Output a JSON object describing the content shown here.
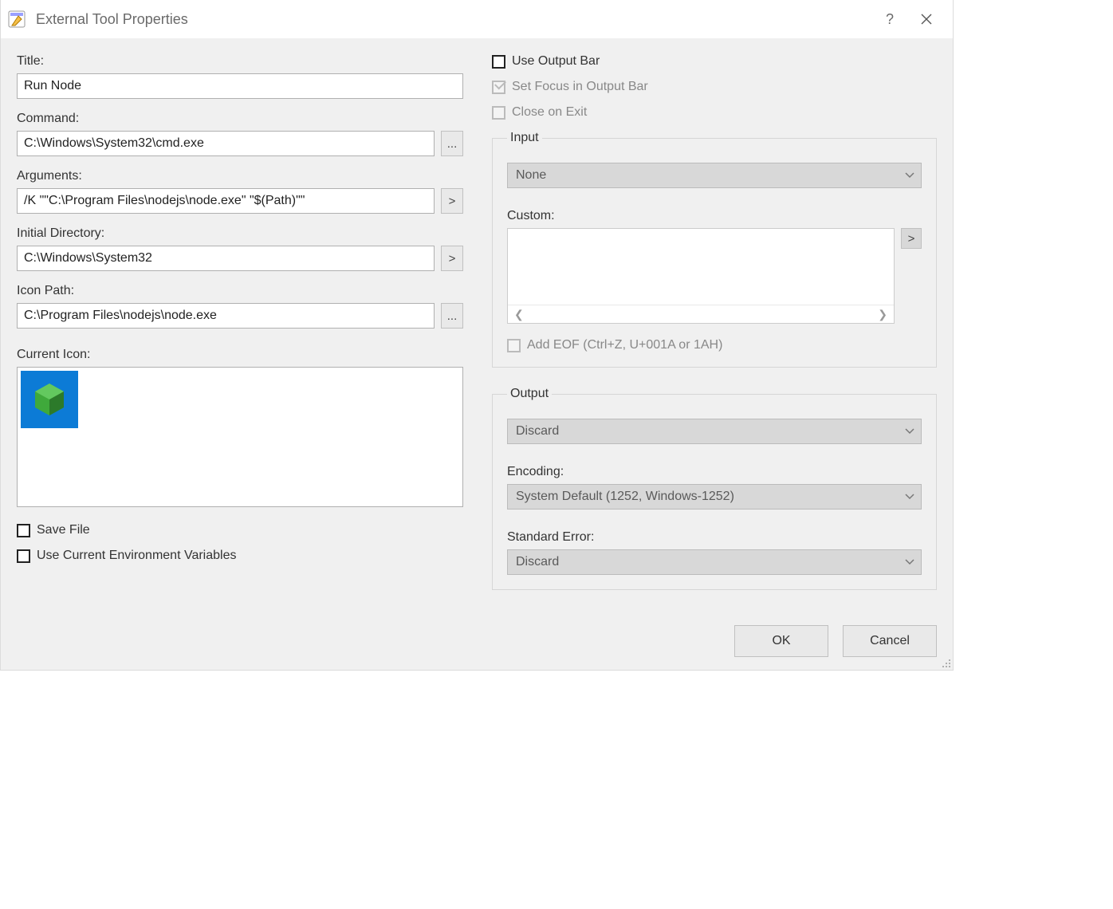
{
  "window": {
    "title": "External Tool Properties"
  },
  "left": {
    "title_label": "Title:",
    "title_value": "Run Node",
    "command_label": "Command:",
    "command_value": "C:\\Windows\\System32\\cmd.exe",
    "arguments_label": "Arguments:",
    "arguments_value": "/K \"\"C:\\Program Files\\nodejs\\node.exe\" \"$(Path)\"\"",
    "initdir_label": "Initial Directory:",
    "initdir_value": "C:\\Windows\\System32",
    "iconpath_label": "Icon Path:",
    "iconpath_value": "C:\\Program Files\\nodejs\\node.exe",
    "currenticon_label": "Current Icon:",
    "savefile_label": "Save File",
    "useenv_label": "Use Current Environment Variables",
    "browse_glyph": "...",
    "insert_glyph": ">"
  },
  "right": {
    "use_output_bar": "Use Output Bar",
    "set_focus": "Set Focus in Output Bar",
    "close_on_exit": "Close on Exit",
    "input_legend": "Input",
    "input_select": "None",
    "custom_label": "Custom:",
    "insert_glyph": ">",
    "add_eof": "Add EOF (Ctrl+Z, U+001A or 1AH)",
    "output_legend": "Output",
    "output_select": "Discard",
    "encoding_label": "Encoding:",
    "encoding_select": "System Default (1252, Windows-1252)",
    "stderr_label": "Standard Error:",
    "stderr_select": "Discard"
  },
  "buttons": {
    "ok": "OK",
    "cancel": "Cancel"
  }
}
